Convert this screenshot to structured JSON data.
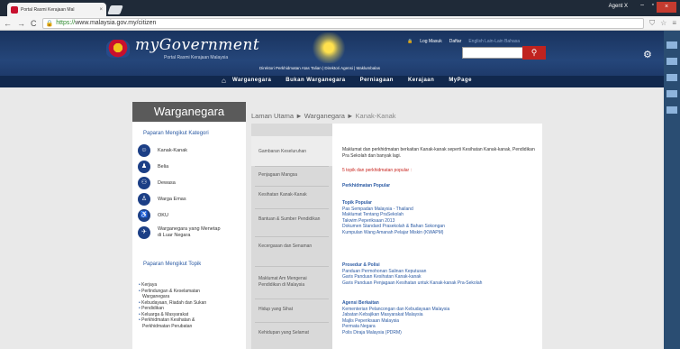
{
  "browser": {
    "tab_title": "Portal Rasmi Kerajaan Mal",
    "url_scheme": "https://",
    "url_rest": "www.malaysia.gov.my/citizen",
    "agent_label": "Agent X"
  },
  "header": {
    "logo": "myGovernment",
    "logo_sub": "Portal Rasmi Kerajaan Malaysia",
    "directory": "Direktori Perkhidmatan Atas Talian | Direktori Agensi | Maklumbalas",
    "login": "Log Masuk",
    "register": "Daftar",
    "lang": "English  Lain-Lain Bahasa"
  },
  "mainnav": [
    "Warganegara",
    "Bukan Warganegara",
    "Perniagaan",
    "Kerajaan",
    "MyPage"
  ],
  "left": {
    "title": "Warganegara",
    "cat_heading": "Paparan Mengikut Kategori",
    "categories": [
      "Kanak-Kanak",
      "Belia",
      "Dewasa",
      "Warga Emas",
      "OKU",
      "Warganegara yang Menetap",
      "di Luar Negara"
    ],
    "topic_heading": "Paparan Mengikut Topik",
    "topics": [
      "Kerjaya",
      "Perlindungan & Keselamatan",
      "Warganegara",
      "Kebudayaan, Riadah dan Sukan",
      "Pendidikan",
      "Keluarga & Masyarakat",
      "Perkhidmatan Kesihatan &",
      "Perkhidmatan Perubatan"
    ]
  },
  "breadcrumb": {
    "home": "Laman Utama",
    "section": "Warganegara",
    "current": "Kanak-Kanak",
    "sep": "►"
  },
  "mid": [
    "Gambaran Keseluruhan",
    "Penjagaan Mangsa",
    "Kesihatan Kanak-Kanak",
    "Bantuan & Sumber Pendidikan",
    "Kecergasan dan Senaman",
    "Maklumat Am Mengenai Pendidikan di Malaysia",
    "Hidup yang Sihat",
    "Kehidupan yang Selamat"
  ],
  "main": {
    "intro": "Maklumat dan perkhidmatan berkaitan Kanak-kanak seperti Kesihatan Kanak-kanak, Pendidikan Pra Sekolah dan banyak lagi.",
    "topics_count": "5 topik dan perkhidmatan popular :",
    "popular_heading": "Perkhidmatan Popular",
    "topik_heading": "Topik Popular",
    "topik": [
      "Pas Sempadan Malaysia - Thailand",
      "Maklumat Tentang PraSekolah",
      "Takwim Peperiksaan 2013",
      "Dokumen Standard Prasekolah & Bahan Sokongan",
      "Kumpulan Wang Amanah Pelajar Miskin (KWAPM)"
    ],
    "prosedur_heading": "Prosedur & Polisi",
    "prosedur": [
      "Panduan Permohonan Salinan Keputusan",
      "Garis Panduan Kesihatan Kanak-kanak",
      "Garis Panduan Penjagaan Kesihatan untuk Kanak-kanak Pra-Sekolah"
    ],
    "agensi_heading": "Agensi Berkaitan",
    "agensi": [
      "Kementerian Pelancongan dan Kebudayaan Malaysia",
      "Jabatan Kebajikan Masyarakat Malaysia",
      "Majlis Peperiksaan Malaysia",
      "Permata Negara",
      "Polis Diraja Malaysia (PDRM)"
    ]
  },
  "colors": {
    "header": "#19335e",
    "nav": "#11284d",
    "search_button": "#c0231f",
    "link": "#2b5aa3"
  }
}
